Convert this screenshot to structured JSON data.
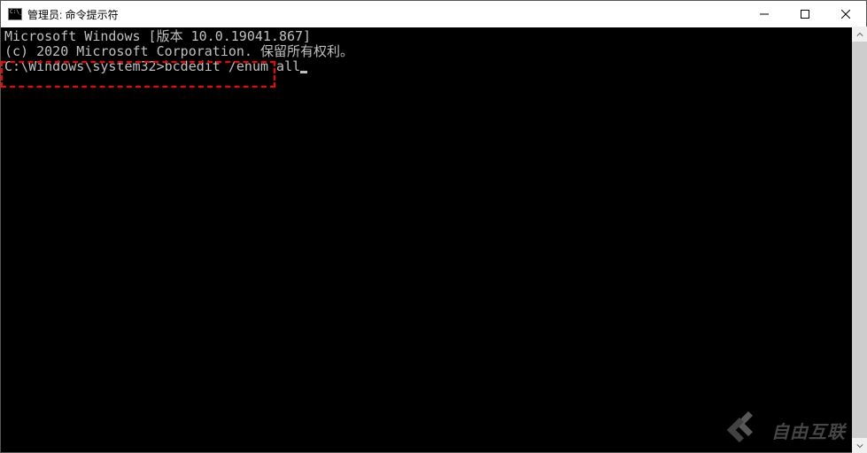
{
  "titlebar": {
    "title": "管理员: 命令提示符"
  },
  "terminal": {
    "line1": "Microsoft Windows [版本 10.0.19041.867]",
    "line2": "(c) 2020 Microsoft Corporation. 保留所有权利。",
    "blank": "",
    "prompt": "C:\\Windows\\system32>",
    "command": "bcdedit /enum all"
  },
  "watermark": {
    "text": "自由互联"
  }
}
